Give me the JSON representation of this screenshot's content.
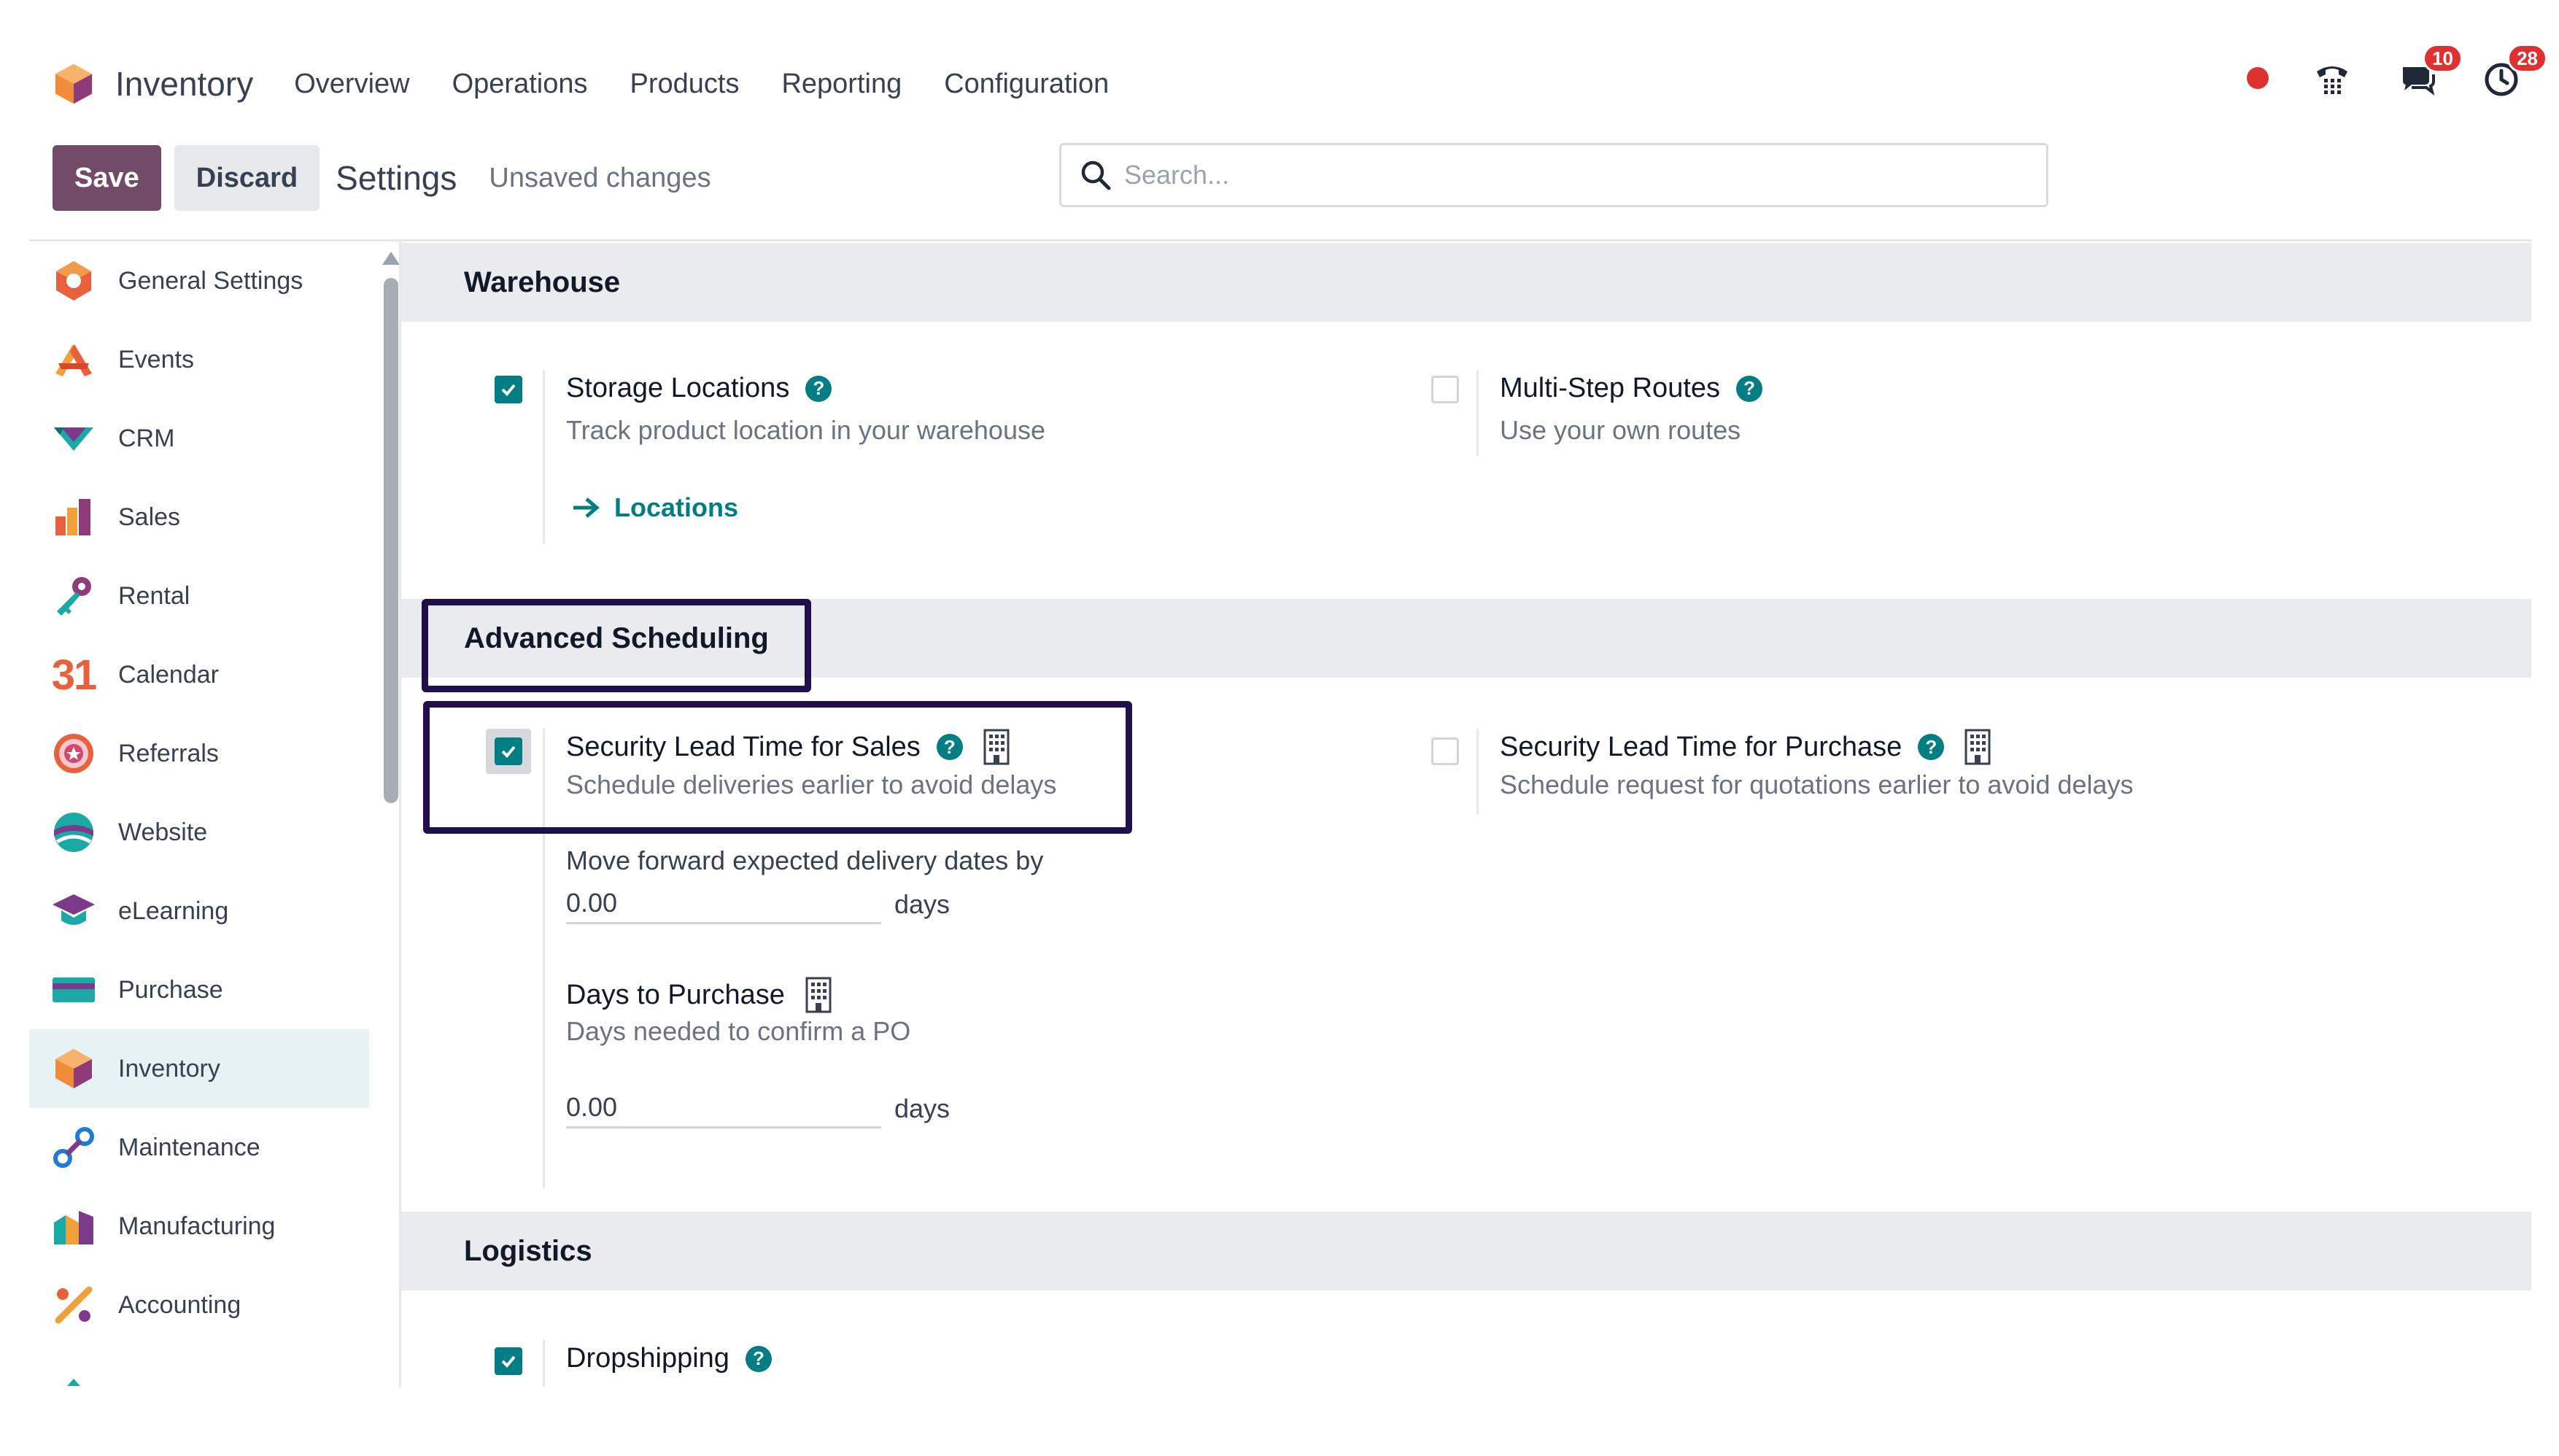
{
  "navbar": {
    "app_name": "Inventory",
    "menu": [
      "Overview",
      "Operations",
      "Products",
      "Reporting",
      "Configuration"
    ],
    "messages_badge": "10",
    "activities_badge": "28"
  },
  "control_panel": {
    "save_label": "Save",
    "discard_label": "Discard",
    "title": "Settings",
    "status": "Unsaved changes",
    "search_placeholder": "Search..."
  },
  "sidebar": {
    "items": [
      {
        "label": "General Settings",
        "icon": "general-settings-icon"
      },
      {
        "label": "Events",
        "icon": "events-icon"
      },
      {
        "label": "CRM",
        "icon": "crm-icon"
      },
      {
        "label": "Sales",
        "icon": "sales-icon"
      },
      {
        "label": "Rental",
        "icon": "rental-icon"
      },
      {
        "label": "Calendar",
        "icon": "calendar-icon"
      },
      {
        "label": "Referrals",
        "icon": "referrals-icon"
      },
      {
        "label": "Website",
        "icon": "website-icon"
      },
      {
        "label": "eLearning",
        "icon": "elearning-icon"
      },
      {
        "label": "Purchase",
        "icon": "purchase-icon"
      },
      {
        "label": "Inventory",
        "icon": "inventory-icon",
        "active": true
      },
      {
        "label": "Maintenance",
        "icon": "maintenance-icon"
      },
      {
        "label": "Manufacturing",
        "icon": "manufacturing-icon"
      },
      {
        "label": "Accounting",
        "icon": "accounting-icon"
      }
    ],
    "calendar_glyph": "31"
  },
  "sections": {
    "warehouse": {
      "title": "Warehouse",
      "storage_locations": {
        "title": "Storage Locations",
        "desc": "Track product location in your warehouse",
        "checked": true,
        "link": "Locations"
      },
      "multi_step_routes": {
        "title": "Multi-Step Routes",
        "desc": "Use your own routes",
        "checked": false
      }
    },
    "advanced_scheduling": {
      "title": "Advanced Scheduling",
      "lead_time_sales": {
        "title": "Security Lead Time for Sales",
        "desc": "Schedule deliveries earlier to avoid delays",
        "checked": true,
        "field_label": "Move forward expected delivery dates by",
        "value": "0.00",
        "unit": "days"
      },
      "lead_time_purchase": {
        "title": "Security Lead Time for Purchase",
        "desc": "Schedule request for quotations earlier to avoid delays",
        "checked": false
      },
      "days_to_purchase": {
        "title": "Days to Purchase",
        "desc": "Days needed to confirm a PO",
        "value": "0.00",
        "unit": "days"
      }
    },
    "logistics": {
      "title": "Logistics",
      "dropshipping": {
        "title": "Dropshipping",
        "checked": true
      }
    }
  },
  "colors": {
    "brand": "#714B67",
    "accent": "#017e84",
    "highlight": "#1f0f4a",
    "badge": "#e03131"
  }
}
